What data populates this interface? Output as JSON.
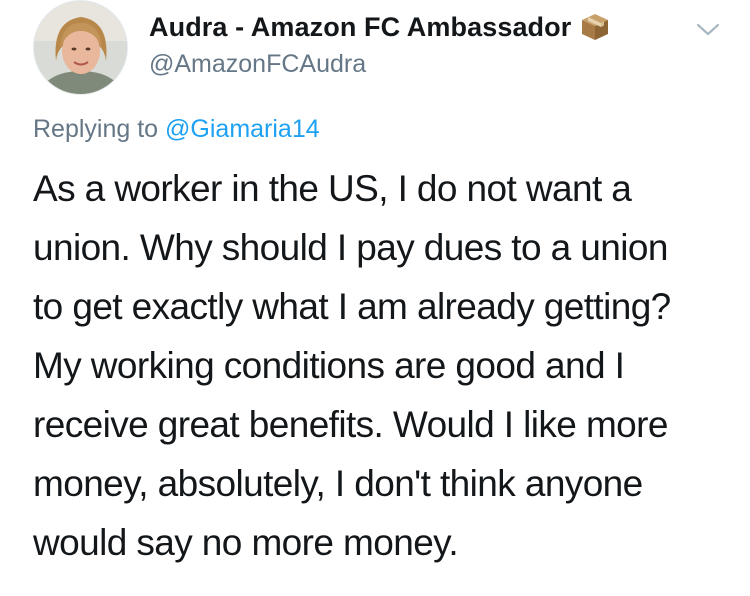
{
  "author": {
    "display_name": "Audra - Amazon FC Ambassador",
    "handle": "@AmazonFCAudra",
    "badge_icon": "package-box-icon",
    "avatar_icon": "profile-photo"
  },
  "menu": {
    "caret_icon": "chevron-down-icon"
  },
  "reply": {
    "prefix": "Replying to ",
    "target": "@Giamaria14"
  },
  "tweet": {
    "lines": [
      "As a worker in the US, I do not want a",
      "union. Why should I pay dues to a union",
      "to get exactly what I am already getting?",
      "My working conditions are good and I",
      "receive great benefits. Would I like more",
      "money, absolutely, I don't think anyone",
      "would say no more money."
    ]
  },
  "colors": {
    "text": "#14171a",
    "secondary": "#657786",
    "link": "#1da1f2"
  }
}
